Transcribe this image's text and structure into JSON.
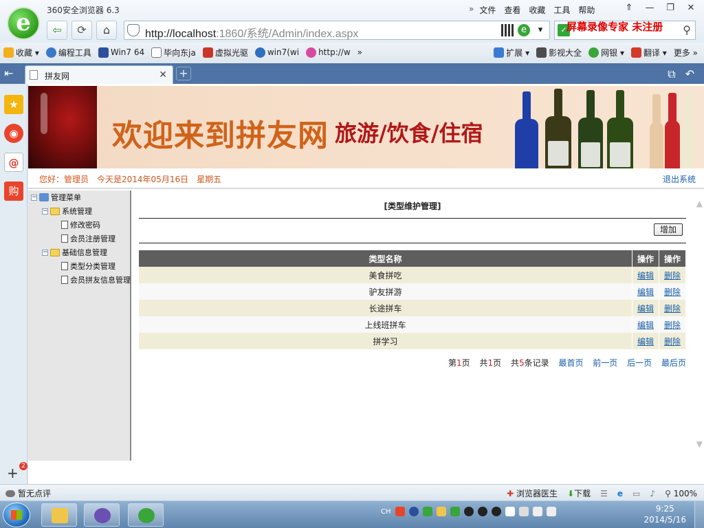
{
  "browser": {
    "title": "360安全浏览器 6.3",
    "menu": [
      "文件",
      "查看",
      "收藏",
      "工具",
      "帮助"
    ],
    "menu_more": "»",
    "window_buttons": [
      "⇑",
      "—",
      "❐",
      "✕"
    ],
    "url_host": "http://localhost",
    "url_rest": ":1860/系统/Admin/index.aspx",
    "recorder_text": "屏幕录像专家  未注册",
    "tab_title": "拼友网",
    "bookmarks": [
      {
        "label": "收藏 ▾",
        "color": "#f2b01e"
      },
      {
        "label": "编程工具",
        "color": "#3c78c8"
      },
      {
        "label": "Win7 64",
        "color": "#2b4f9c"
      },
      {
        "label": "毕向东ja",
        "color": "#ffffff"
      },
      {
        "label": "虚拟光驱",
        "color": "#c8352b"
      },
      {
        "label": "win7(wi",
        "color": "#2f6fc0"
      },
      {
        "label": "http://w",
        "color": "#d64aa0"
      }
    ],
    "bookmarks_more": "»",
    "bookmarks_right": [
      {
        "label": "扩展 ▾",
        "color": "#3a7bd5"
      },
      {
        "label": "影视大全",
        "color": "#4d4d4d"
      },
      {
        "label": "网银 ▾",
        "color": "#3aa53a"
      },
      {
        "label": "翻译 ▾",
        "color": "#d23a2a"
      },
      {
        "label": "更多 »",
        "color": "transparent"
      }
    ],
    "status_left": "暂无点评",
    "status_right": [
      "浏览器医生",
      "下载",
      "100%"
    ]
  },
  "page": {
    "banner_title": "欢迎来到拼友网",
    "banner_subtitle": "旅游/饮食/住宿",
    "greeting": [
      "您好：管理员",
      "今天是2014年05月16日",
      "星期五"
    ],
    "logout": "退出系统",
    "tree": {
      "root": "管理菜单",
      "groups": [
        {
          "label": "系统管理",
          "items": [
            "修改密码",
            "会员注册管理"
          ]
        },
        {
          "label": "基础信息管理",
          "items": [
            "类型分类管理",
            "会员拼友信息管理"
          ]
        }
      ]
    },
    "content_title": "[类型维护管理]",
    "add_button": "增加",
    "table": {
      "headers": [
        "类型名称",
        "操作",
        "操作"
      ],
      "rows": [
        {
          "name": "美食拼吃",
          "edit": "编辑",
          "delete": "删除"
        },
        {
          "name": "驴友拼游",
          "edit": "编辑",
          "delete": "删除"
        },
        {
          "name": "长途拼车",
          "edit": "编辑",
          "delete": "删除"
        },
        {
          "name": "上线班拼车",
          "edit": "编辑",
          "delete": "删除"
        },
        {
          "name": "拼学习",
          "edit": "编辑",
          "delete": "删除"
        }
      ]
    },
    "pager": {
      "page_prefix": "第",
      "page_num": "1",
      "page_suffix": "页",
      "total_prefix": "共",
      "total_num": "1",
      "total_suffix": "页",
      "records_prefix": "共",
      "records_num": "5",
      "records_suffix": "条记录",
      "first": "最首页",
      "prev": "前一页",
      "next": "后一页",
      "last": "最后页"
    }
  },
  "taskbar": {
    "ime": "CH",
    "time": "9:25",
    "date": "2014/5/16"
  },
  "colors": {
    "tab_bar": "#4e73a4",
    "greeting": "#d2541c",
    "link": "#1a5fa8",
    "table_header": "#5e5e5e",
    "row_odd": "#efedd8",
    "recorder": "#e00000"
  }
}
